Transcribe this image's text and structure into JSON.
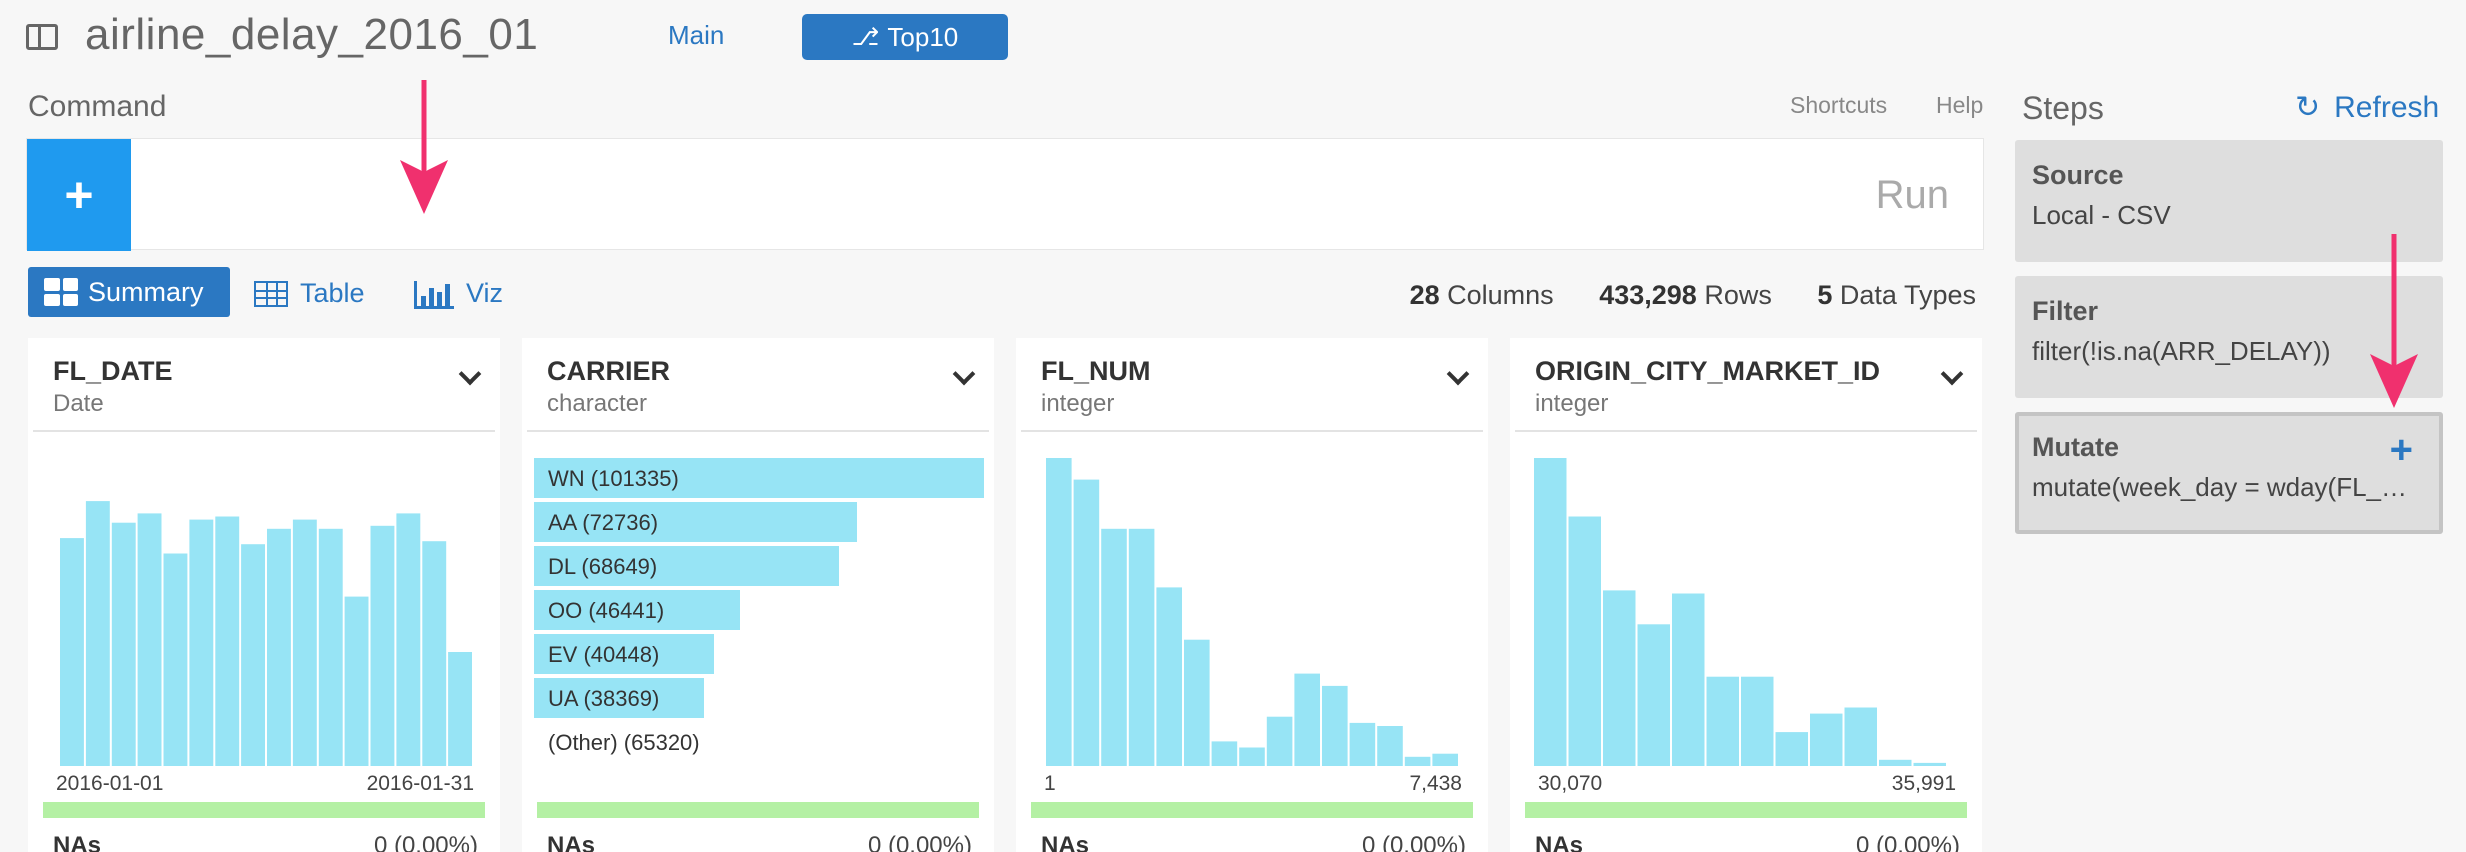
{
  "header": {
    "title": "airline_delay_2016_01",
    "branch_main": "Main",
    "branch_active": "Top10",
    "branch_icon": "git-branch-icon"
  },
  "command": {
    "label": "Command",
    "shortcuts": "Shortcuts",
    "help": "Help",
    "add_label": "+",
    "run_label": "Run"
  },
  "view_tabs": {
    "summary": "Summary",
    "table": "Table",
    "viz": "Viz",
    "active": "Summary"
  },
  "stats": {
    "columns_count": "28",
    "columns_label": "Columns",
    "rows_count": "433,298",
    "rows_label": "Rows",
    "types_count": "5",
    "types_label": "Data Types"
  },
  "columns": [
    {
      "name": "FL_DATE",
      "type": "Date",
      "min": "2016-01-01",
      "max": "2016-01-31",
      "na_label": "NAs",
      "na_value": "0 (0.00%)",
      "histogram": [
        0.74,
        0.86,
        0.79,
        0.82,
        0.69,
        0.8,
        0.81,
        0.72,
        0.77,
        0.8,
        0.77,
        0.55,
        0.78,
        0.82,
        0.73,
        0.37
      ]
    },
    {
      "name": "CARRIER",
      "type": "character",
      "na_label": "NAs",
      "na_value": "0 (0.00%)",
      "categories": [
        {
          "label": "WN (101335)",
          "value": 101335
        },
        {
          "label": "AA (72736)",
          "value": 72736
        },
        {
          "label": "DL (68649)",
          "value": 68649
        },
        {
          "label": "OO (46441)",
          "value": 46441
        },
        {
          "label": "EV (40448)",
          "value": 40448
        },
        {
          "label": "UA (38369)",
          "value": 38369
        },
        {
          "label": "(Other) (65320)",
          "value": null
        }
      ]
    },
    {
      "name": "FL_NUM",
      "type": "integer",
      "min": "1",
      "max": "7,438",
      "na_label": "NAs",
      "na_value": "0 (0.00%)",
      "histogram": [
        1.0,
        0.93,
        0.77,
        0.77,
        0.58,
        0.41,
        0.08,
        0.06,
        0.16,
        0.3,
        0.26,
        0.14,
        0.13,
        0.03,
        0.04
      ]
    },
    {
      "name": "ORIGIN_CITY_MARKET_ID",
      "type": "integer",
      "min": "30,070",
      "max": "35,991",
      "na_label": "NAs",
      "na_value": "0 (0.00%)",
      "histogram": [
        1.0,
        0.81,
        0.57,
        0.46,
        0.56,
        0.29,
        0.29,
        0.11,
        0.17,
        0.19,
        0.02,
        0.01
      ]
    }
  ],
  "steps": {
    "title": "Steps",
    "refresh": "Refresh",
    "items": [
      {
        "title": "Source",
        "desc": "Local - CSV"
      },
      {
        "title": "Filter",
        "desc": "filter(!is.na(ARR_DELAY))"
      },
      {
        "title": "Mutate",
        "desc": "mutate(week_day = wday(FL_DATE))"
      }
    ]
  },
  "colors": {
    "accent": "#2b78c2",
    "add_button": "#1f9aef",
    "histogram_bar": "#97e4f5",
    "na_bar": "#b4f0a4",
    "annotation_arrow": "#f0306e"
  }
}
